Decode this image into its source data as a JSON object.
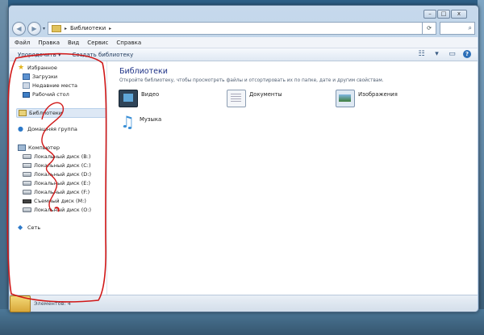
{
  "window": {
    "caption_buttons": [
      "–",
      "□",
      "x"
    ],
    "address": {
      "path": "Библиотеки",
      "separator": "▸"
    }
  },
  "menu": [
    "Файл",
    "Правка",
    "Вид",
    "Сервис",
    "Справка"
  ],
  "toolbar": {
    "organize": "Упорядочить ▾",
    "create_library": "Создать библиотеку",
    "help": "?"
  },
  "sidebar": {
    "favorites_header": "Избранное",
    "favorites": [
      "Загрузки",
      "Недавние места",
      "Рабочий стол"
    ],
    "libraries": "Библиотеки",
    "homegroup": "Домашняя группа",
    "computer": "Компьютер",
    "drives": [
      "Локальный диск (B:)",
      "Локальный диск (C:)",
      "Локальный диск (D:)",
      "Локальный диск (E:)",
      "Локальный диск (F:)",
      "Съемный диск (M:)",
      "Локальный диск (O:)"
    ],
    "network": "Сеть"
  },
  "main": {
    "title": "Библиотеки",
    "subtitle": "Откройте библиотеку, чтобы просмотреть файлы и отсортировать их по папке, дате и другим свойствам.",
    "libraries": [
      {
        "name": "Видео",
        "icon": "video-library-icon"
      },
      {
        "name": "Документы",
        "icon": "documents-library-icon"
      },
      {
        "name": "Изображения",
        "icon": "pictures-library-icon"
      },
      {
        "name": "Музыка",
        "icon": "music-library-icon"
      }
    ]
  },
  "status": {
    "text": "Элементов: 4"
  },
  "colors": {
    "title_blue": "#1e3287",
    "annotation_red": "#d01818",
    "window_frame": "#b4cbe3"
  }
}
